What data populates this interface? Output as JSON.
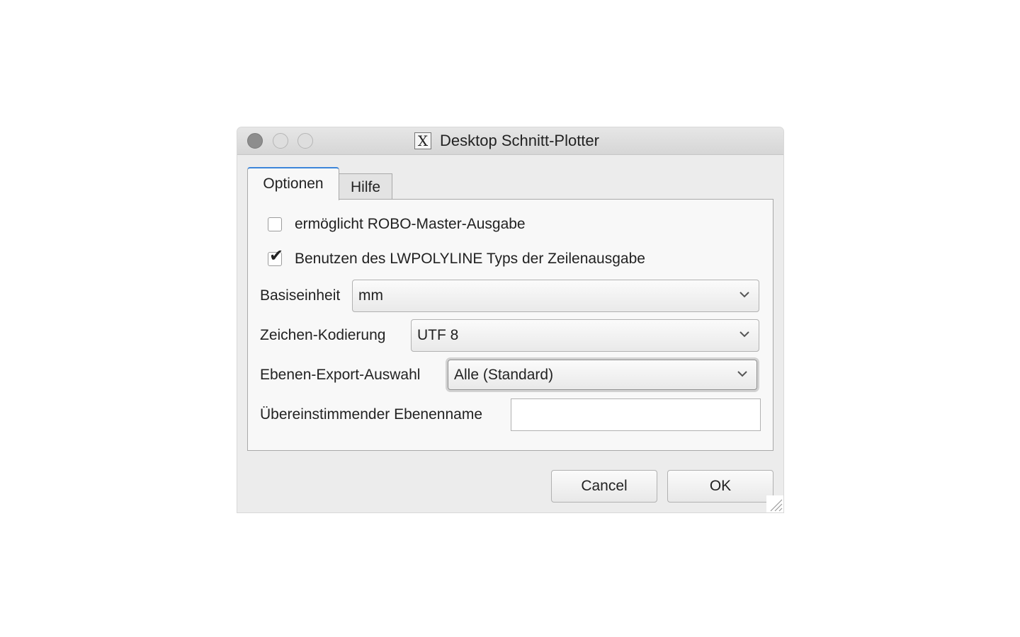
{
  "window": {
    "title": "Desktop Schnitt-Plotter",
    "app_icon_glyph": "X"
  },
  "tabs": [
    {
      "label": "Optionen",
      "active": true
    },
    {
      "label": "Hilfe",
      "active": false
    }
  ],
  "options": {
    "robo_master": {
      "label": "ermöglicht ROBO-Master-Ausgabe",
      "checked": false
    },
    "lwpolyline": {
      "label": "Benutzen des LWPOLYLINE Typs der Zeilenausgabe",
      "checked": true
    },
    "base_unit": {
      "label": "Basiseinheit",
      "value": "mm"
    },
    "encoding": {
      "label": "Zeichen-Kodierung",
      "value": "UTF 8"
    },
    "layer_export": {
      "label": "Ebenen-Export-Auswahl",
      "value": "Alle (Standard)"
    },
    "layer_name": {
      "label": "Übereinstimmender Ebenenname",
      "value": "",
      "placeholder": ""
    }
  },
  "buttons": {
    "cancel": "Cancel",
    "ok": "OK"
  },
  "icons": {
    "window_close": "close-icon",
    "window_minimize": "minimize-icon",
    "window_maximize": "maximize-icon",
    "app": "x11-icon",
    "check": "checkmark-icon",
    "dropdown": "chevron-down-icon",
    "resize": "resize-grip-icon"
  },
  "colors": {
    "active_tab_accent": "#3d86d9",
    "close_button": "#8d8d8d"
  }
}
